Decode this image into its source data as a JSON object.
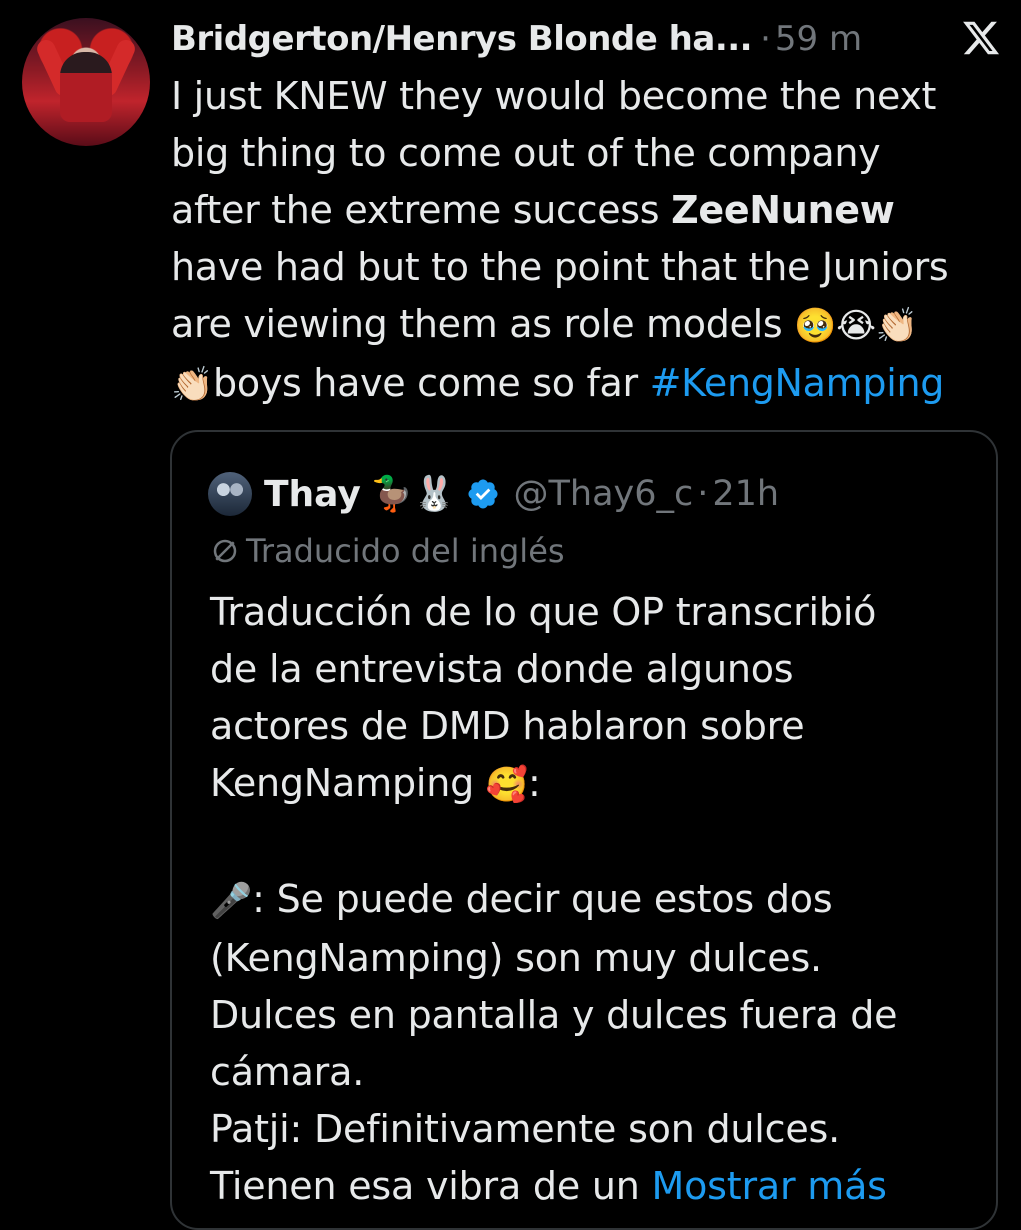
{
  "tweet": {
    "author_name": "Bridgerton/Henrys Blonde ha...",
    "separator": "·",
    "time": "59 m",
    "close_icon": "x-logo-icon",
    "lines": [
      {
        "pre": "I just KNEW they would become the next"
      },
      {
        "pre": "big thing to come out of the company"
      },
      {
        "pre": "after the extreme success ",
        "bold": "ZeeNunew"
      },
      {
        "pre": "have had but to the point that the Juniors"
      },
      {
        "pre": "are viewing them as role models ",
        "emoji": "🥹😭👏🏻"
      },
      {
        "emoji_start": "👏🏻",
        "pre": "boys have come so far ",
        "hashtag": "#KengNamping"
      }
    ]
  },
  "quote": {
    "name": "Thay",
    "name_emojis": "🦆🐰",
    "handle": "@Thay6_c",
    "separator": "·",
    "time": "21h",
    "translated_label": "Traducido del inglés",
    "lines": [
      {
        "text": "Traducción de lo que OP transcribió"
      },
      {
        "text": "de la entrevista donde algunos"
      },
      {
        "text": "actores de DMD hablaron sobre"
      },
      {
        "text": "KengNamping ",
        "emoji": "🥰",
        "after": ":"
      },
      {
        "text": ""
      },
      {
        "emoji_start": "🎤",
        "text": ": Se puede decir que estos dos"
      },
      {
        "text": "(KengNamping) son muy dulces."
      },
      {
        "text": "Dulces en pantalla y dulces fuera de"
      },
      {
        "text": "cámara."
      },
      {
        "text": "Patji: Definitivamente son dulces."
      },
      {
        "text": "Tienen esa vibra de un ",
        "link": "Mostrar más"
      }
    ]
  },
  "colors": {
    "background": "#000000",
    "text": "#e7e9ea",
    "muted": "#71767b",
    "link": "#1d9bf0",
    "border": "#2f3336"
  }
}
